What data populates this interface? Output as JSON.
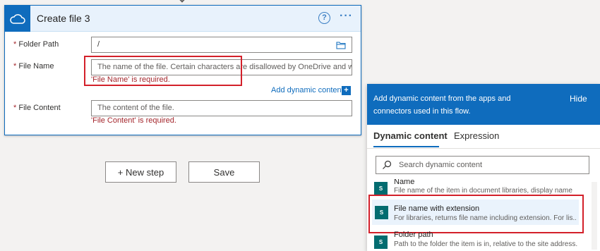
{
  "card": {
    "title": "Create file 3",
    "help_glyph": "?",
    "more_glyph": "···",
    "required_star": "*",
    "fields": {
      "folder_path": {
        "label": "Folder Path",
        "value": "/"
      },
      "file_name": {
        "label": "File Name",
        "placeholder": "The name of the file. Certain characters are disallowed by OneDrive and will be",
        "error": "'File Name' is required."
      },
      "file_content": {
        "label": "File Content",
        "placeholder": "The content of the file.",
        "error": "'File Content' is required."
      }
    },
    "add_dynamic": "Add dynamic content",
    "plus_glyph": "+"
  },
  "buttons": {
    "new_step": "+ New step",
    "save": "Save"
  },
  "panel": {
    "header_text": "Add dynamic content from the apps and connectors used in this flow.",
    "hide": "Hide",
    "tabs": [
      "Dynamic content",
      "Expression"
    ],
    "search_placeholder": "Search dynamic content",
    "items": [
      {
        "title": "Name",
        "desc": "File name of the item in document libraries, display name"
      },
      {
        "title": "File name with extension",
        "desc": "For libraries, returns file name including extension. For lis..."
      },
      {
        "title": "Folder path",
        "desc": "Path to the folder the item is in, relative to the site address."
      }
    ]
  },
  "colors": {
    "accent": "#0f6cbd",
    "error": "#a4262c",
    "highlight": "#d3202a",
    "sharepoint": "#036c70"
  },
  "icons": [
    "onedrive-cloud-icon",
    "help-icon",
    "more-options-icon",
    "folder-browse-icon",
    "search-icon",
    "sharepoint-icon"
  ]
}
